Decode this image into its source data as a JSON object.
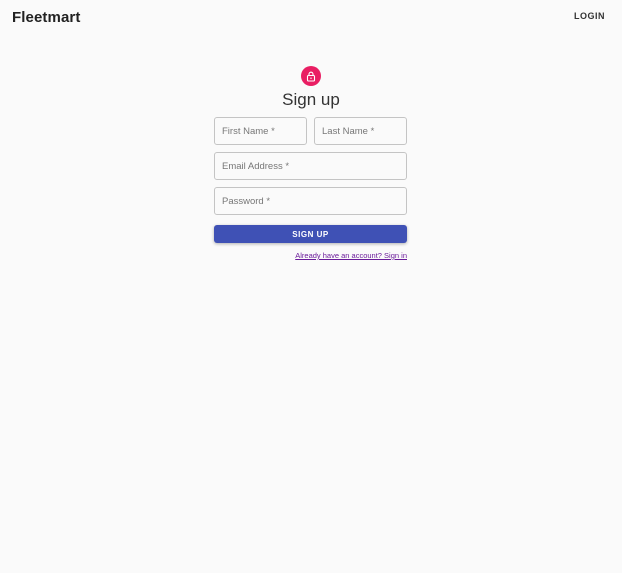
{
  "app": {
    "brand": "Fleetmart",
    "login_label": "LOGIN"
  },
  "form": {
    "title": "Sign up",
    "icon": "lock-icon",
    "first_name_label": "First Name *",
    "last_name_label": "Last Name *",
    "email_label": "Email Address *",
    "password_label": "Password *",
    "submit_label": "SIGN UP",
    "signin_link": "Already have an account? Sign in"
  },
  "colors": {
    "background": "#fafafa",
    "avatar": "#e91e63",
    "primary_button": "#3f51b5",
    "link": "#6a1b9a"
  }
}
